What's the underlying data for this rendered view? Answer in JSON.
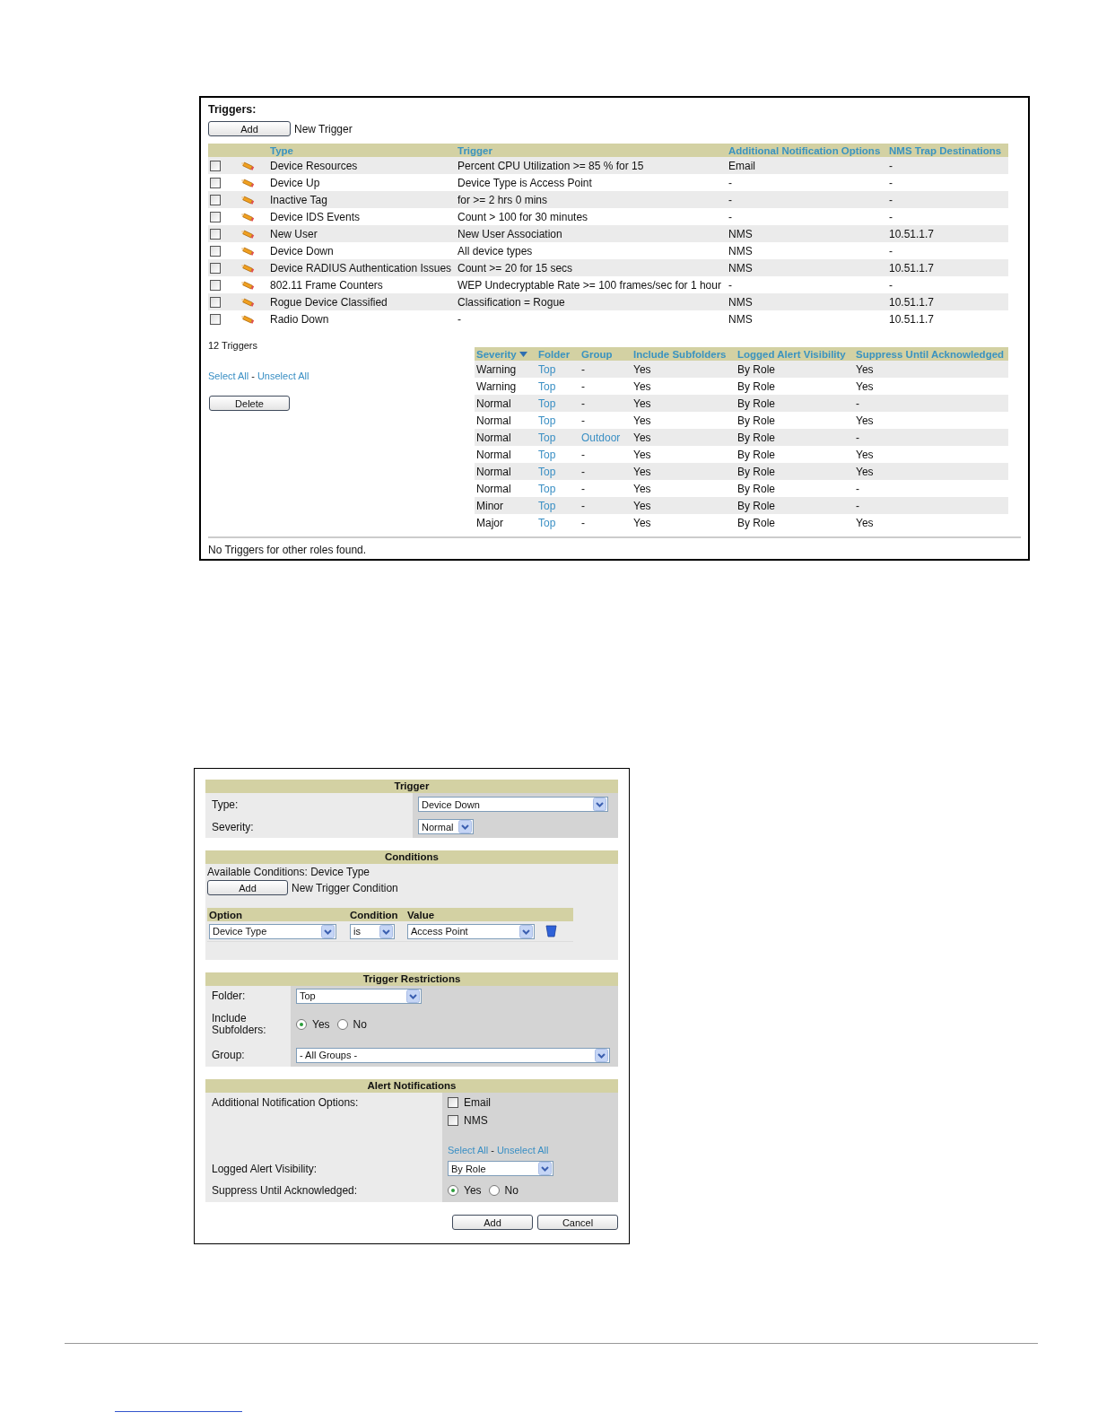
{
  "triggers_panel": {
    "title": "Triggers:",
    "add_button": "Add",
    "add_label": "New Trigger",
    "columns": [
      "Type",
      "Trigger",
      "Additional Notification Options",
      "NMS Trap Destinations"
    ],
    "columns_2": [
      {
        "label": "Severity",
        "sorted": true
      },
      {
        "label": "Folder",
        "sorted": false
      },
      {
        "label": "Group",
        "sorted": false
      },
      {
        "label": "Include Subfolders",
        "sorted": false
      },
      {
        "label": "Logged Alert Visibility",
        "sorted": false
      },
      {
        "label": "Suppress Until Acknowledged",
        "sorted": false
      }
    ],
    "rows": [
      {
        "checked": false,
        "type": "Device Resources",
        "trigger": "Percent CPU Utilization >= 85 % for 15",
        "notification": "Email",
        "nms": "-",
        "severity": "Warning",
        "folder": "Top",
        "group": "-",
        "group_link": false,
        "include_subfolders": "Yes",
        "visibility": "By Role",
        "suppress": "Yes"
      },
      {
        "checked": false,
        "type": "Device Up",
        "trigger": "Device Type is Access Point",
        "notification": "-",
        "nms": "-",
        "severity": "Warning",
        "folder": "Top",
        "group": "-",
        "group_link": false,
        "include_subfolders": "Yes",
        "visibility": "By Role",
        "suppress": "Yes"
      },
      {
        "checked": false,
        "type": "Inactive Tag",
        "trigger": "for >= 2 hrs 0 mins",
        "notification": "-",
        "nms": "-",
        "severity": "Normal",
        "folder": "Top",
        "group": "-",
        "group_link": false,
        "include_subfolders": "Yes",
        "visibility": "By Role",
        "suppress": "-"
      },
      {
        "checked": false,
        "type": "Device IDS Events",
        "trigger": "Count > 100 for 30 minutes",
        "notification": "-",
        "nms": "-",
        "severity": "Normal",
        "folder": "Top",
        "group": "-",
        "group_link": false,
        "include_subfolders": "Yes",
        "visibility": "By Role",
        "suppress": "Yes"
      },
      {
        "checked": false,
        "type": "New User",
        "trigger": "New User Association",
        "notification": "NMS",
        "nms": "10.51.1.7",
        "severity": "Normal",
        "folder": "Top",
        "group": "Outdoor",
        "group_link": true,
        "include_subfolders": "Yes",
        "visibility": "By Role",
        "suppress": "-"
      },
      {
        "checked": false,
        "type": "Device Down",
        "trigger": "All device types",
        "notification": "NMS",
        "nms": "-",
        "severity": "Normal",
        "folder": "Top",
        "group": "-",
        "group_link": false,
        "include_subfolders": "Yes",
        "visibility": "By Role",
        "suppress": "Yes"
      },
      {
        "checked": false,
        "type": "Device RADIUS Authentication Issues",
        "trigger": "Count >= 20 for 15 secs",
        "notification": "NMS",
        "nms": "10.51.1.7",
        "severity": "Normal",
        "folder": "Top",
        "group": "-",
        "group_link": false,
        "include_subfolders": "Yes",
        "visibility": "By Role",
        "suppress": "Yes"
      },
      {
        "checked": false,
        "type": "802.11 Frame Counters",
        "trigger": "WEP Undecryptable Rate >= 100 frames/sec for 1 hour",
        "notification": "-",
        "nms": "-",
        "severity": "Normal",
        "folder": "Top",
        "group": "-",
        "group_link": false,
        "include_subfolders": "Yes",
        "visibility": "By Role",
        "suppress": "-"
      },
      {
        "checked": false,
        "type": "Rogue Device Classified",
        "trigger": "Classification = Rogue",
        "notification": "NMS",
        "nms": "10.51.1.7",
        "severity": "Minor",
        "folder": "Top",
        "group": "-",
        "group_link": false,
        "include_subfolders": "Yes",
        "visibility": "By Role",
        "suppress": "-"
      },
      {
        "checked": false,
        "type": "Radio Down",
        "trigger": "-",
        "notification": "NMS",
        "nms": "10.51.1.7",
        "severity": "Major",
        "folder": "Top",
        "group": "-",
        "group_link": false,
        "include_subfolders": "Yes",
        "visibility": "By Role",
        "suppress": "Yes"
      }
    ],
    "count": "12 Triggers",
    "select_all": "Select All",
    "separator": "-",
    "unselect_all": "Unselect All",
    "delete_button": "Delete",
    "footer": "No Triggers for other roles found."
  },
  "trigger_form": {
    "trigger_section": {
      "title": "Trigger",
      "type_label": "Type:",
      "type_value": "Device Down",
      "severity_label": "Severity:",
      "severity_value": "Normal"
    },
    "conditions_section": {
      "title": "Conditions",
      "available": "Available Conditions: Device Type",
      "add_button": "Add",
      "add_label": "New Trigger Condition",
      "columns": [
        "Option",
        "Condition",
        "Value"
      ],
      "option_value": "Device Type",
      "condition_value": "is",
      "value_value": "Access Point"
    },
    "restrictions_section": {
      "title": "Trigger Restrictions",
      "folder_label": "Folder:",
      "folder_value": "Top",
      "include_label": "Include Subfolders:",
      "include_options": [
        {
          "label": "Yes",
          "selected": true
        },
        {
          "label": "No",
          "selected": false
        }
      ],
      "group_label": "Group:",
      "group_value": "- All Groups -"
    },
    "alerts_section": {
      "title": "Alert Notifications",
      "options_label": "Additional Notification Options:",
      "options": [
        {
          "label": "Email",
          "checked": false
        },
        {
          "label": "NMS",
          "checked": false
        }
      ],
      "select_all": "Select All",
      "separator": "-",
      "unselect_all": "Unselect All",
      "visibility_label": "Logged Alert Visibility:",
      "visibility_value": "By Role",
      "suppress_label": "Suppress Until Acknowledged:",
      "suppress_options": [
        {
          "label": "Yes",
          "selected": true
        },
        {
          "label": "No",
          "selected": false
        }
      ]
    },
    "buttons": [
      "Add",
      "Cancel"
    ]
  }
}
